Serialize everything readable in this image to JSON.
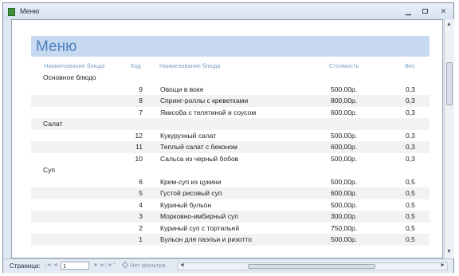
{
  "window": {
    "title": "Меню"
  },
  "report": {
    "title": "Меню",
    "columns": [
      "Наименование блюда",
      "Код",
      "Наименование блюда",
      "Стоимость",
      "Вес"
    ],
    "rows": [
      {
        "group": "Основное блюдо",
        "code": "",
        "name": "",
        "price": "",
        "weight": ""
      },
      {
        "group": "",
        "code": "9",
        "name": "Овощи в воке",
        "price": "500,00р.",
        "weight": "0,3"
      },
      {
        "group": "",
        "code": "8",
        "name": "Спринг-роллы с креветками",
        "price": "800,00р.",
        "weight": "0,3"
      },
      {
        "group": "",
        "code": "7",
        "name": "Якисоба с телятиной и соусом",
        "price": "600,00р.",
        "weight": "0,3"
      },
      {
        "group": "Салат",
        "code": "",
        "name": "",
        "price": "",
        "weight": ""
      },
      {
        "group": "",
        "code": "12",
        "name": "Кукурузный салат",
        "price": "500,00р.",
        "weight": "0,3"
      },
      {
        "group": "",
        "code": "11",
        "name": "Теплый салат с беконом",
        "price": "600,00р.",
        "weight": "0,3"
      },
      {
        "group": "",
        "code": "10",
        "name": "Сальса из черный бобов",
        "price": "500,00р.",
        "weight": "0,3"
      },
      {
        "group": "Суп",
        "code": "",
        "name": "",
        "price": "",
        "weight": ""
      },
      {
        "group": "",
        "code": "6",
        "name": "Крем-суп из цукини",
        "price": "500,00р.",
        "weight": "0,5"
      },
      {
        "group": "",
        "code": "5",
        "name": "Густой рисовый суп",
        "price": "600,00р.",
        "weight": "0,5"
      },
      {
        "group": "",
        "code": "4",
        "name": "Куриный бульон",
        "price": "500,00р.",
        "weight": "0,5"
      },
      {
        "group": "",
        "code": "3",
        "name": "Морковно-имбирный суп",
        "price": "300,00р.",
        "weight": "0,5"
      },
      {
        "group": "",
        "code": "2",
        "name": "Куриный суп с тортильей",
        "price": "750,00р.",
        "weight": "0,5"
      },
      {
        "group": "",
        "code": "1",
        "name": "Бульон для паэльи и ризотто",
        "price": "500,00р.",
        "weight": "0,5"
      }
    ]
  },
  "status": {
    "page_label": "Страница:",
    "page_value": "1",
    "filter_label": "Нет фильтра"
  }
}
